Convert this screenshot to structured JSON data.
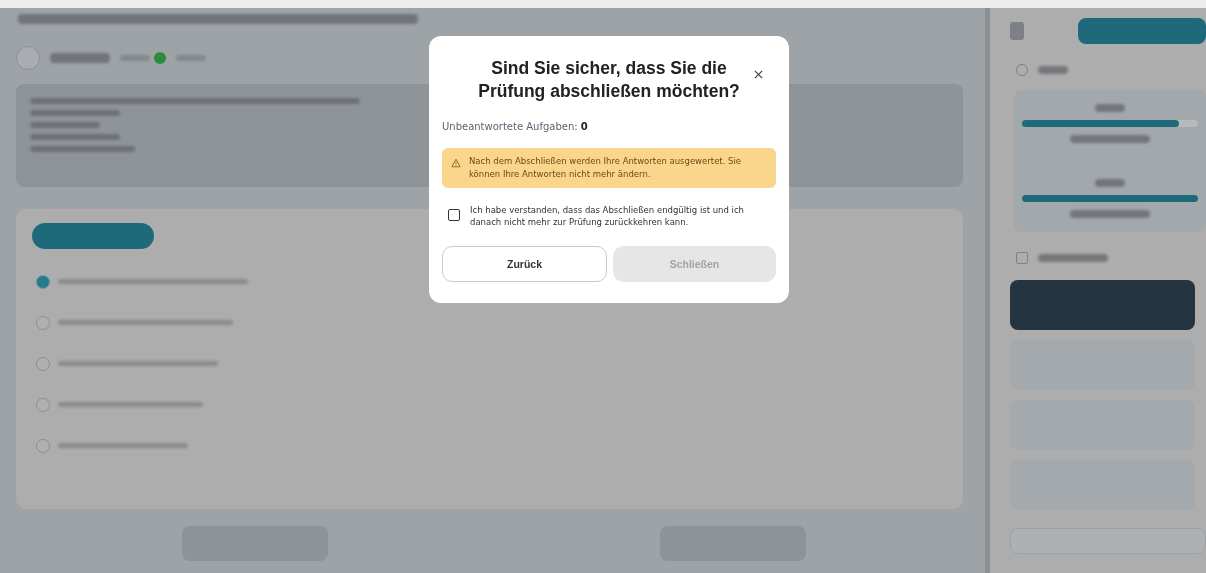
{
  "background": {
    "answer_options": [
      {
        "selected": true
      },
      {
        "selected": false
      },
      {
        "selected": false
      },
      {
        "selected": false
      },
      {
        "selected": false
      }
    ],
    "progress": [
      {
        "level": 0.89
      },
      {
        "level": 1
      }
    ],
    "task_list": [
      {
        "selected": true
      },
      {
        "selected": false
      },
      {
        "selected": false
      },
      {
        "selected": false
      }
    ]
  },
  "dialog": {
    "title": "Sind Sie sicher, dass Sie die Prüfung abschließen möchten?",
    "unanswered_label": "Unbeantwortete Aufgaben:",
    "unanswered_count": "0",
    "warning": "Nach dem Abschließen werden Ihre Antworten ausgewertet. Sie können Ihre Antworten nicht mehr ändern.",
    "confirm": {
      "label": "Ich habe verstanden, dass das Abschließen endgültig ist und ich danach nicht mehr zur Prüfung zurückkehren kann.",
      "checked": false
    },
    "buttons": [
      {
        "label": "Zurück",
        "kind": "secondary",
        "disabled": false
      },
      {
        "label": "Schließen",
        "kind": "primary",
        "disabled": true
      }
    ]
  }
}
